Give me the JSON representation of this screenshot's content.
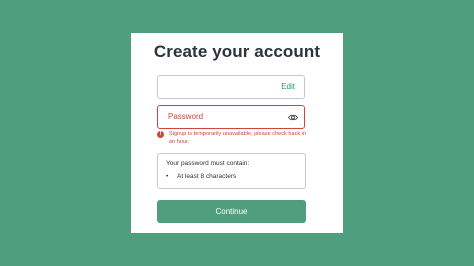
{
  "title": "Create your account",
  "email_field": {
    "value": "",
    "edit_label": "Edit"
  },
  "password_field": {
    "label": "Password",
    "toggle_icon": "eye-icon"
  },
  "error": {
    "icon": "alert-circle-icon",
    "icon_glyph": "!",
    "message": "Signup is temporarily unavailable, please check back in an hour."
  },
  "requirements": {
    "heading": "Your password must contain:",
    "bullet": "•",
    "items": [
      "At least 8 characters"
    ]
  },
  "continue_label": "Continue",
  "colors": {
    "background": "#4f9f7f",
    "accent": "#10a37f",
    "error": "#d0463c",
    "text": "#2d333a"
  }
}
